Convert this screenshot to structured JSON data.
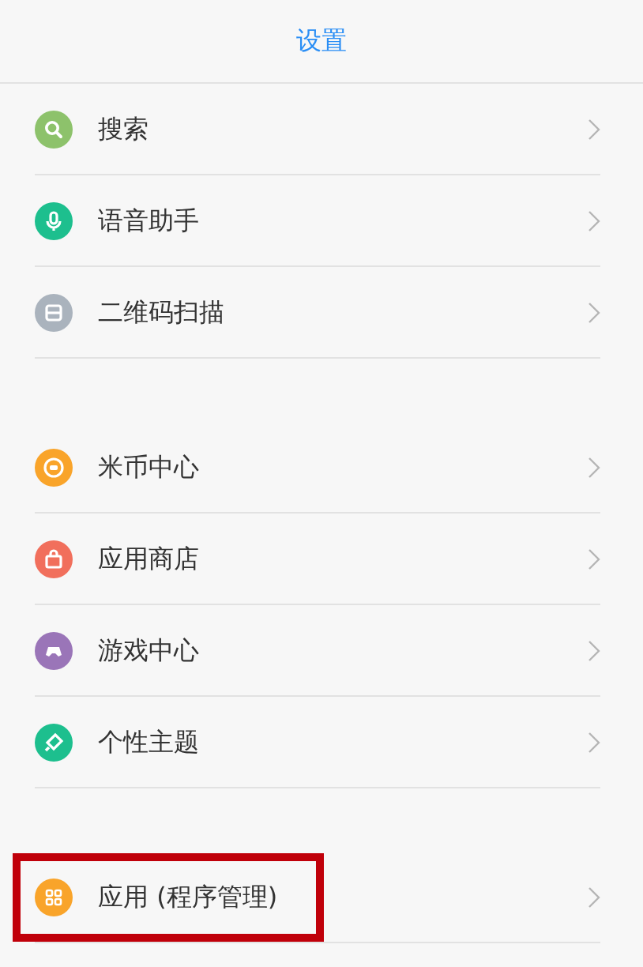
{
  "header": {
    "title": "设置"
  },
  "groups": [
    {
      "items": [
        {
          "label": "搜索",
          "kind": "search",
          "color": "#8dc26b",
          "highlighted": false
        },
        {
          "label": "语音助手",
          "kind": "mic",
          "color": "#1dbf8e",
          "highlighted": false
        },
        {
          "label": "二维码扫描",
          "kind": "scan",
          "color": "#aab3bd",
          "highlighted": false
        }
      ]
    },
    {
      "items": [
        {
          "label": "米币中心",
          "kind": "coin",
          "color": "#f9a42a",
          "highlighted": false
        },
        {
          "label": "应用商店",
          "kind": "bag",
          "color": "#f16f5c",
          "highlighted": false
        },
        {
          "label": "游戏中心",
          "kind": "gamepad",
          "color": "#9a75b8",
          "highlighted": false
        },
        {
          "label": "个性主题",
          "kind": "brush",
          "color": "#1dbf8e",
          "highlighted": false
        }
      ]
    },
    {
      "items": [
        {
          "label": "应用 (程序管理)",
          "kind": "apps",
          "color": "#f9a42a",
          "highlighted": true
        }
      ]
    }
  ]
}
